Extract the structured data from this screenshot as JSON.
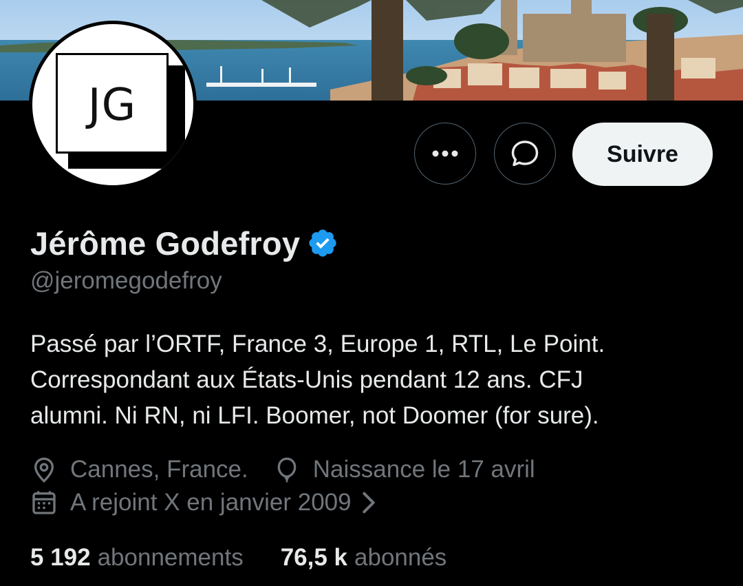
{
  "profile": {
    "avatar_initials": "JG",
    "name": "Jérôme Godefroy",
    "handle": "@jeromegodefroy",
    "bio_lines": [
      "Passé par l’ORTF, France 3, Europe 1, RTL, Le Point.",
      "Correspondant aux États-Unis pendant 12 ans. CFJ",
      "alumni. Ni RN, ni LFI. Boomer, not Doomer (for sure)."
    ],
    "location": "Cannes, France.",
    "birthday": "Naissance le 17 avril",
    "joined": "A rejoint X en janvier 2009"
  },
  "actions": {
    "more_icon": "more-icon",
    "message_icon": "message-icon",
    "follow_label": "Suivre"
  },
  "stats": {
    "following_count": "5 192",
    "following_label": "abonnements",
    "followers_count": "76,5 k",
    "followers_label": "abonnés"
  },
  "icons": {
    "verified": "verified-badge-icon",
    "location": "location-pin-icon",
    "birthday": "balloon-icon",
    "calendar": "calendar-icon",
    "chevron": "chevron-right-icon"
  },
  "colors": {
    "background": "#000000",
    "text_primary": "#e7e9ea",
    "text_secondary": "#71767b",
    "verified_blue": "#1d9bf0",
    "button_border": "#536471",
    "follow_bg": "#eff3f4"
  }
}
